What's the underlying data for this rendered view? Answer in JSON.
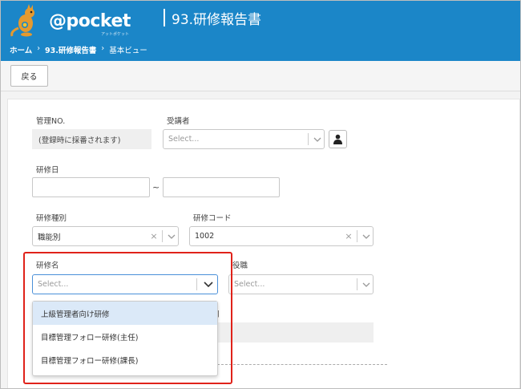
{
  "header": {
    "logo_text": "@pocket",
    "logo_sub": "アットポケット",
    "page_title": "93.研修報告書",
    "breadcrumb": [
      "ホーム",
      "93.研修報告書",
      "基本ビュー"
    ],
    "breadcrumb_sep": "›"
  },
  "toolbar": {
    "back_label": "戻る"
  },
  "form": {
    "kanri_no": {
      "label": "管理NO.",
      "value": "(登録時に採番されます)"
    },
    "jukousha": {
      "label": "受講者",
      "placeholder": "Select..."
    },
    "kenshu_bi": {
      "label": "研修日",
      "tilde": "~"
    },
    "kenshu_shubetsu": {
      "label": "研修種別",
      "value": "職能別"
    },
    "kenshu_code": {
      "label": "研修コード",
      "value": "1002"
    },
    "kenshu_mei": {
      "label": "研修名",
      "placeholder": "Select..."
    },
    "yakushoku": {
      "label": "役職",
      "placeholder": "Select..."
    },
    "partial_label": "関",
    "clear_glyph": "×"
  },
  "dropdown": {
    "options": [
      "上級管理者向け研修",
      "目標管理フォロー研修(主任)",
      "目標管理フォロー研修(課長)"
    ],
    "active_index": 0
  },
  "colors": {
    "header_bg": "#1b86c8",
    "highlight": "#e0221a",
    "option_hover": "#dbe9f8"
  }
}
